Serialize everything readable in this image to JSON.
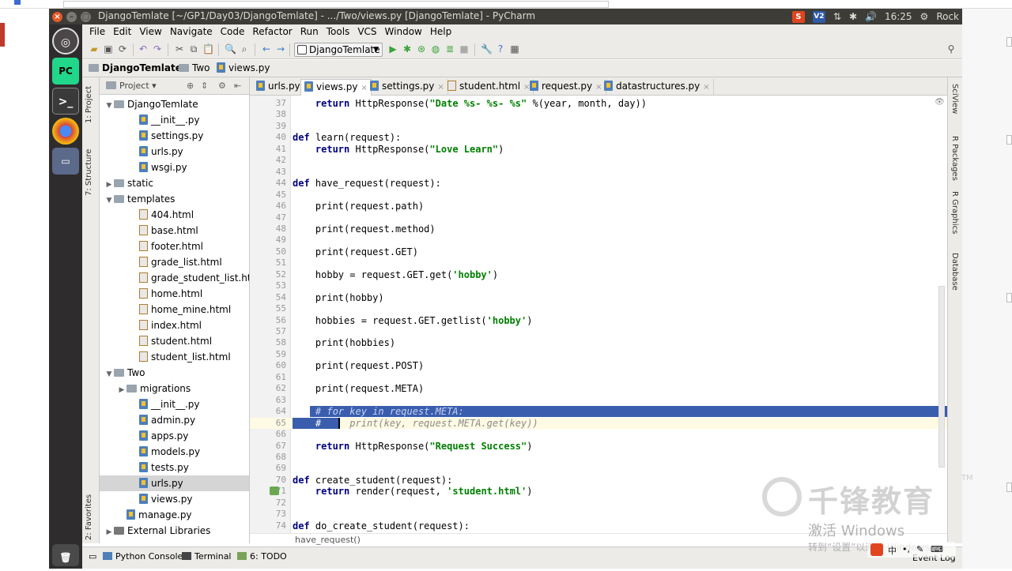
{
  "window": {
    "title": "DjangoTemlate [~/GP1/Day03/DjangoTemlate] - .../Two/views.py [DjangoTemlate] - PyCharm",
    "tray": {
      "ime": "S",
      "vp": "V2",
      "time": "16:25",
      "user": "Rock"
    }
  },
  "launcher": {
    "items": [
      "ubuntu-dash",
      "pycharm",
      "terminal",
      "chrome",
      "files",
      "trash"
    ]
  },
  "menu": [
    "File",
    "Edit",
    "View",
    "Navigate",
    "Code",
    "Refactor",
    "Run",
    "Tools",
    "VCS",
    "Window",
    "Help"
  ],
  "toolbar": {
    "run_config": "DjangoTemlate"
  },
  "navbar": {
    "crumbs": [
      "DjangoTemlate",
      "Two",
      "views.py"
    ]
  },
  "project_panel": {
    "header": "Project",
    "rows": [
      {
        "label": "DjangoTemlate",
        "type": "folder",
        "indent": 1,
        "expanded": true
      },
      {
        "label": "__init__.py",
        "type": "py",
        "indent": 3
      },
      {
        "label": "settings.py",
        "type": "py",
        "indent": 3
      },
      {
        "label": "urls.py",
        "type": "py",
        "indent": 3
      },
      {
        "label": "wsgi.py",
        "type": "py",
        "indent": 3
      },
      {
        "label": "static",
        "type": "folder",
        "indent": 1,
        "expanded": false
      },
      {
        "label": "templates",
        "type": "folder",
        "indent": 1,
        "expanded": true
      },
      {
        "label": "404.html",
        "type": "html",
        "indent": 3
      },
      {
        "label": "base.html",
        "type": "html",
        "indent": 3
      },
      {
        "label": "footer.html",
        "type": "html",
        "indent": 3
      },
      {
        "label": "grade_list.html",
        "type": "html",
        "indent": 3
      },
      {
        "label": "grade_student_list.html",
        "type": "html",
        "indent": 3
      },
      {
        "label": "home.html",
        "type": "html",
        "indent": 3
      },
      {
        "label": "home_mine.html",
        "type": "html",
        "indent": 3
      },
      {
        "label": "index.html",
        "type": "html",
        "indent": 3
      },
      {
        "label": "student.html",
        "type": "html",
        "indent": 3
      },
      {
        "label": "student_list.html",
        "type": "html",
        "indent": 3
      },
      {
        "label": "Two",
        "type": "folder",
        "indent": 1,
        "expanded": true
      },
      {
        "label": "migrations",
        "type": "folder",
        "indent": 2,
        "expanded": false
      },
      {
        "label": "__init__.py",
        "type": "py",
        "indent": 3
      },
      {
        "label": "admin.py",
        "type": "py",
        "indent": 3
      },
      {
        "label": "apps.py",
        "type": "py",
        "indent": 3
      },
      {
        "label": "models.py",
        "type": "py",
        "indent": 3
      },
      {
        "label": "tests.py",
        "type": "py",
        "indent": 3
      },
      {
        "label": "urls.py",
        "type": "py",
        "indent": 3,
        "selected": true
      },
      {
        "label": "views.py",
        "type": "py",
        "indent": 3
      },
      {
        "label": "manage.py",
        "type": "py",
        "indent": 2
      },
      {
        "label": "External Libraries",
        "type": "lib",
        "indent": 1,
        "expanded": false
      }
    ]
  },
  "side_tabs_left": [
    "1: Project",
    "7: Structure",
    "2: Favorites"
  ],
  "side_tabs_right": [
    "SciView",
    "R Packages",
    "R Graphics",
    "Database"
  ],
  "editor_tabs": [
    {
      "label": "urls.py",
      "active": false
    },
    {
      "label": "views.py",
      "active": true
    },
    {
      "label": "settings.py",
      "active": false
    },
    {
      "label": "student.html",
      "active": false
    },
    {
      "label": "request.py",
      "active": false
    },
    {
      "label": "datastructures.py",
      "active": false
    }
  ],
  "code_lines": [
    {
      "n": "37",
      "html": "    <span class='kw'>return</span> HttpResponse(<span class='str'>\"Date %s- %s- %s\"</span> %(year, month, day))"
    },
    {
      "n": "38",
      "html": ""
    },
    {
      "n": "39",
      "html": ""
    },
    {
      "n": "40",
      "html": "<span class='kw'>def</span> learn(request):"
    },
    {
      "n": "41",
      "html": "    <span class='kw'>return</span> HttpResponse(<span class='str'>\"Love Learn\"</span>)"
    },
    {
      "n": "42",
      "html": ""
    },
    {
      "n": "43",
      "html": ""
    },
    {
      "n": "44",
      "html": "<span class='kw'>def</span> have_request(request):"
    },
    {
      "n": "45",
      "html": ""
    },
    {
      "n": "46",
      "html": "    print(request.path)"
    },
    {
      "n": "47",
      "html": ""
    },
    {
      "n": "48",
      "html": "    print(request.method)"
    },
    {
      "n": "49",
      "html": ""
    },
    {
      "n": "50",
      "html": "    print(request.GET)"
    },
    {
      "n": "51",
      "html": ""
    },
    {
      "n": "52",
      "html": "    hobby = request.GET.get(<span class='str'>'hobby'</span>)"
    },
    {
      "n": "53",
      "html": ""
    },
    {
      "n": "54",
      "html": "    print(hobby)"
    },
    {
      "n": "55",
      "html": ""
    },
    {
      "n": "56",
      "html": "    hobbies = request.GET.getlist(<span class='str'>'hobby'</span>)"
    },
    {
      "n": "57",
      "html": ""
    },
    {
      "n": "58",
      "html": "    print(hobbies)"
    },
    {
      "n": "59",
      "html": ""
    },
    {
      "n": "60",
      "html": "    print(request.POST)"
    },
    {
      "n": "61",
      "html": ""
    },
    {
      "n": "62",
      "html": "    print(request.META)"
    },
    {
      "n": "63",
      "html": ""
    },
    {
      "n": "64",
      "html": "    <span class='cm' style='color:#c7d3f0'># for key in request.META:</span>"
    },
    {
      "n": "65",
      "html": "    <span class='cm' style='color:#fff'>#</span>     <span class='cm'>print(key, request.META.get(key))</span>"
    },
    {
      "n": "66",
      "html": ""
    },
    {
      "n": "67",
      "html": "    <span class='kw'>return</span> HttpResponse(<span class='str'>\"Request Success\"</span>)"
    },
    {
      "n": "68",
      "html": ""
    },
    {
      "n": "69",
      "html": ""
    },
    {
      "n": "70",
      "html": "<span class='kw'>def</span> create_student(request):"
    },
    {
      "n": "71",
      "html": "    <span class='kw'>return</span> render(request, <span class='str'>'student.html'</span>)"
    },
    {
      "n": "72",
      "html": ""
    },
    {
      "n": "73",
      "html": ""
    },
    {
      "n": "74",
      "html": "<span class='kw'>def</span> do_create_student(request):"
    }
  ],
  "editor_breadcrumb": "have_request()",
  "bottom_tabs": [
    "Python Console",
    "Terminal",
    "6: TODO"
  ],
  "event_log": "Event Log",
  "watermark": {
    "brand": "千锋教育",
    "tm": "TM",
    "activate_line1": "激活 Windows",
    "activate_line2": "转到“设置”以激活 Windows。"
  },
  "colors": {
    "selection": "#3a5dae",
    "keyword": "#000080",
    "string": "#008000",
    "titlebar": "#3d3c37",
    "launcher": "#2f2c2e"
  }
}
